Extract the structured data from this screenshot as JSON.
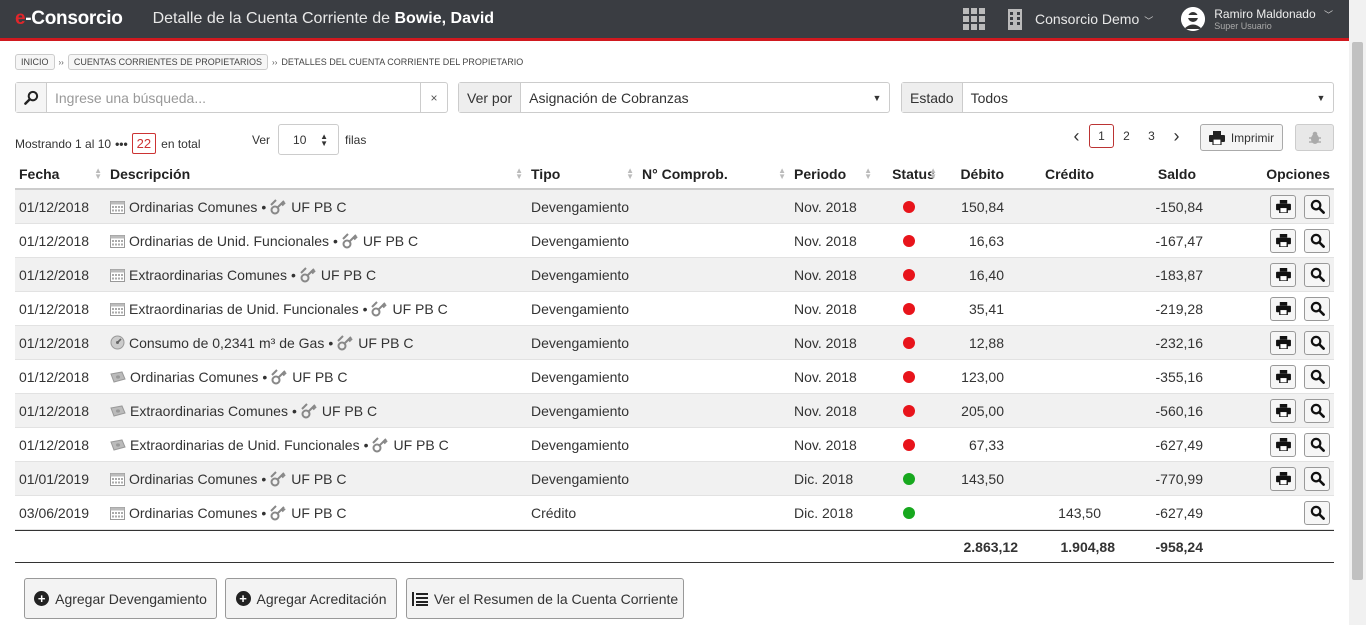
{
  "header": {
    "logo_e": "e",
    "logo_rest": "-Consorcio",
    "title_prefix": "Detalle de la Cuenta Corriente de",
    "title_owner": "Bowie, David",
    "consorcio": "Consorcio Demo",
    "user_name": "Ramiro Maldonado",
    "user_role": "Super Usuario",
    "colors": {
      "bar": "#3a3d42",
      "accent": "#d0191f"
    }
  },
  "breadcrumb": [
    "INICIO",
    "CUENTAS CORRIENTES DE PROPIETARIOS",
    "DETALLES DEL CUENTA CORRIENTE DEL PROPIETARIO"
  ],
  "search": {
    "placeholder": "Ingrese una búsqueda...",
    "value": "",
    "clear": "×"
  },
  "ver_por": {
    "label": "Ver por",
    "value": "Asignación de Cobranzas"
  },
  "estado": {
    "label": "Estado",
    "value": "Todos"
  },
  "showing": {
    "prefix": "Mostrando 1 al 10",
    "dots": "•••",
    "total": "22",
    "suffix": "en total"
  },
  "rows_per_page": {
    "label": "Ver",
    "value": "10",
    "suffix": "filas"
  },
  "pagination": {
    "prev": "‹",
    "pages": [
      "1",
      "2",
      "3"
    ],
    "current": "1",
    "next": "›"
  },
  "print_label": "Imprimir",
  "table": {
    "headers": {
      "fecha": "Fecha",
      "descripcion": "Descripción",
      "tipo": "Tipo",
      "comprobante": "N° Comprob.",
      "periodo": "Periodo",
      "status": "Status",
      "debito": "Débito",
      "credito": "Crédito",
      "saldo": "Saldo",
      "opciones": "Opciones"
    },
    "rows": [
      {
        "fecha": "01/12/2018",
        "icon": "calendar-icon",
        "desc": "Ordinarias Comunes",
        "unit": "UF PB C",
        "tipo": "Devengamiento",
        "comp": "",
        "periodo": "Nov. 2018",
        "status": "red",
        "debito": "150,84",
        "credito": "",
        "saldo": "-150,84",
        "print": true
      },
      {
        "fecha": "01/12/2018",
        "icon": "calendar-icon",
        "desc": "Ordinarias de Unid. Funcionales",
        "unit": "UF PB C",
        "tipo": "Devengamiento",
        "comp": "",
        "periodo": "Nov. 2018",
        "status": "red",
        "debito": "16,63",
        "credito": "",
        "saldo": "-167,47",
        "print": true
      },
      {
        "fecha": "01/12/2018",
        "icon": "calendar-icon",
        "desc": "Extraordinarias Comunes",
        "unit": "UF PB C",
        "tipo": "Devengamiento",
        "comp": "",
        "periodo": "Nov. 2018",
        "status": "red",
        "debito": "16,40",
        "credito": "",
        "saldo": "-183,87",
        "print": true
      },
      {
        "fecha": "01/12/2018",
        "icon": "calendar-icon",
        "desc": "Extraordinarias de Unid. Funcionales",
        "unit": "UF PB C",
        "tipo": "Devengamiento",
        "comp": "",
        "periodo": "Nov. 2018",
        "status": "red",
        "debito": "35,41",
        "credito": "",
        "saldo": "-219,28",
        "print": true
      },
      {
        "fecha": "01/12/2018",
        "icon": "gauge-icon",
        "desc": "Consumo de 0,2341 m³ de Gas ",
        "unit": "UF PB C",
        "tipo": "Devengamiento",
        "comp": "",
        "periodo": "Nov. 2018",
        "status": "red",
        "debito": "12,88",
        "credito": "",
        "saldo": "-232,16",
        "print": true
      },
      {
        "fecha": "01/12/2018",
        "icon": "money-icon",
        "desc": "Ordinarias Comunes",
        "unit": "UF PB C",
        "tipo": "Devengamiento",
        "comp": "",
        "periodo": "Nov. 2018",
        "status": "red",
        "debito": "123,00",
        "credito": "",
        "saldo": "-355,16",
        "print": true
      },
      {
        "fecha": "01/12/2018",
        "icon": "money-icon",
        "desc": "Extraordinarias Comunes",
        "unit": "UF PB C",
        "tipo": "Devengamiento",
        "comp": "",
        "periodo": "Nov. 2018",
        "status": "red",
        "debito": "205,00",
        "credito": "",
        "saldo": "-560,16",
        "print": true
      },
      {
        "fecha": "01/12/2018",
        "icon": "money-icon",
        "desc": "Extraordinarias de Unid. Funcionales",
        "unit": "UF PB C",
        "tipo": "Devengamiento",
        "comp": "",
        "periodo": "Nov. 2018",
        "status": "red",
        "debito": "67,33",
        "credito": "",
        "saldo": "-627,49",
        "print": true
      },
      {
        "fecha": "01/01/2019",
        "icon": "calendar-icon",
        "desc": "Ordinarias Comunes",
        "unit": "UF PB C",
        "tipo": "Devengamiento",
        "comp": "",
        "periodo": "Dic. 2018",
        "status": "green",
        "debito": "143,50",
        "credito": "",
        "saldo": "-770,99",
        "print": true
      },
      {
        "fecha": "03/06/2019",
        "icon": "calendar-icon",
        "desc": "Ordinarias Comunes",
        "unit": "UF PB C",
        "tipo": "Crédito",
        "comp": "",
        "periodo": "Dic. 2018",
        "status": "green",
        "debito": "",
        "credito": "143,50",
        "saldo": "-627,49",
        "print": false
      }
    ],
    "totals": {
      "debito": "2.863,12",
      "credito": "1.904,88",
      "saldo": "-958,24"
    },
    "status_colors": {
      "red": "#e8141b",
      "green": "#17a81e"
    }
  },
  "actions": {
    "add_devengamiento": "Agregar Devengamiento",
    "add_acreditacion": "Agregar Acreditación",
    "ver_resumen": "Ver el Resumen de la Cuenta Corriente"
  }
}
